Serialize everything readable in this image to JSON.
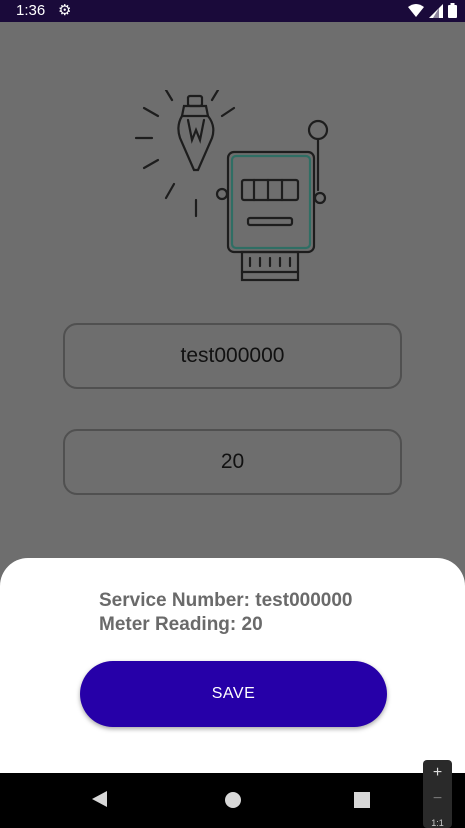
{
  "status_bar": {
    "time": "1:36",
    "settings_icon": "gear-icon",
    "wifi_icon": "wifi-icon",
    "signal_icon": "signal-icon",
    "battery_icon": "battery-icon"
  },
  "form": {
    "illustration_icon": "bulb-and-meter-icon",
    "service_number_value": "test000000",
    "meter_reading_value": "20"
  },
  "sheet": {
    "service_line": "Service Number: test000000",
    "reading_line": "Meter Reading: 20",
    "save_label": "SAVE"
  },
  "zoom": {
    "plus": "+",
    "minus": "−",
    "ratio": "1:1"
  },
  "colors": {
    "accent": "#2600a8",
    "status_bar": "#1a0a3a",
    "scrim": "#6e6e6e"
  }
}
